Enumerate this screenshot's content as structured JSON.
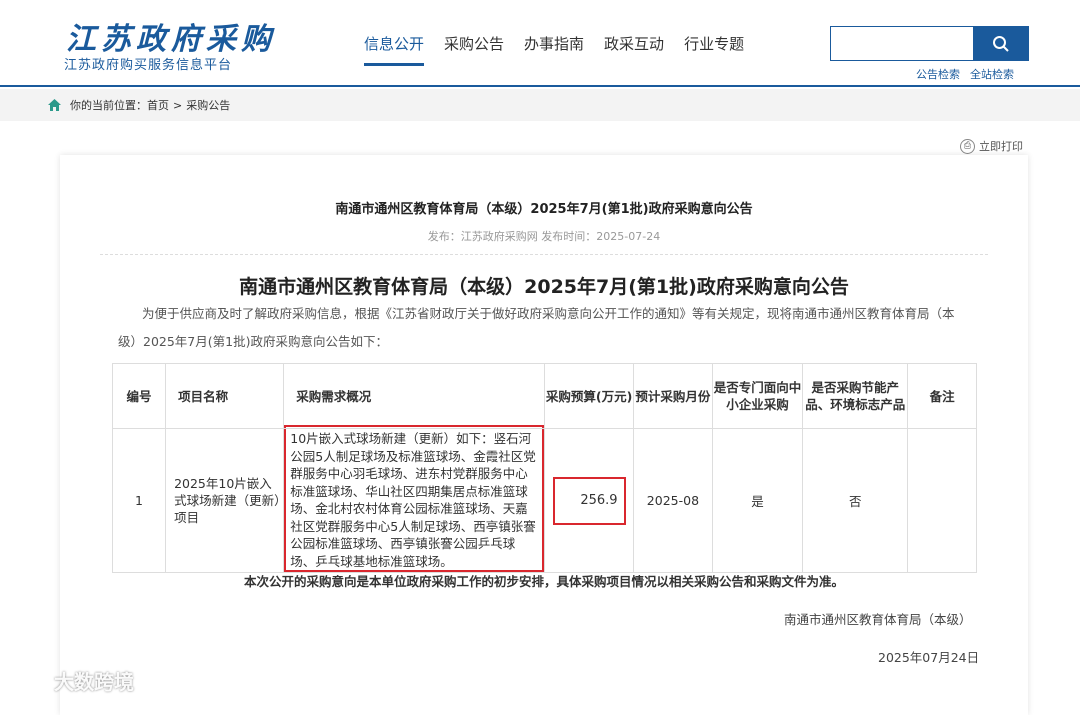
{
  "header": {
    "logo_title": "江苏政府采购",
    "logo_subtitle": "江苏政府购买服务信息平台",
    "logo_seal": "政府采购",
    "nav": [
      {
        "label": "信息公开"
      },
      {
        "label": "采购公告"
      },
      {
        "label": "办事指南"
      },
      {
        "label": "政采互动"
      },
      {
        "label": "行业专题"
      }
    ],
    "search": {
      "value": "",
      "placeholder": ""
    },
    "search_links": [
      "公告检索",
      "全站检索"
    ]
  },
  "breadcrumb": {
    "label": "你的当前位置：",
    "home": "首页",
    "separator": ">",
    "current": "采购公告"
  },
  "print_label": "立即打印",
  "article": {
    "page_title": "南通市通州区教育体育局（本级）2025年7月(第1批)政府采购意向公告",
    "meta": "发布：江苏政府采购网   发布时间：2025-07-24",
    "doc_title": "南通市通州区教育体育局（本级）2025年7月(第1批)政府采购意向公告",
    "intro": "为便于供应商及时了解政府采购信息，根据《江苏省财政厅关于做好政府采购意向公开工作的通知》等有关规定，现将南通市通州区教育体育局（本级）2025年7月(第1批)政府采购意向公告如下：",
    "table": {
      "headers": [
        "编号",
        "项目名称",
        "采购需求概况",
        "采购预算(万元)",
        "预计采购月份",
        "是否专门面向中小企业采购",
        "是否采购节能产品、环境标志产品",
        "备注"
      ],
      "rows": [
        {
          "no": "1",
          "name": "2025年10片嵌入式球场新建（更新）项目",
          "description": "10片嵌入式球场新建（更新）如下：竖石河公园5人制足球场及标准篮球场、金霞社区党群服务中心羽毛球场、进东村党群服务中心标准篮球场、华山社区四期集居点标准篮球场、金北村农村体育公园标准篮球场、天嘉社区党群服务中心5人制足球场、西亭镇张謇公园标准篮球场、西亭镇张謇公园乒乓球场、乒乓球基地标准篮球场。",
          "budget": "256.9",
          "month": "2025-08",
          "sme": "是",
          "green": "否",
          "remark": ""
        }
      ]
    },
    "note": "本次公开的采购意向是本单位政府采购工作的初步安排，具体采购项目情况以相关采购公告和采购文件为准。",
    "sign_org": "南通市通州区教育体育局（本级）",
    "sign_date": "2025年07月24日"
  },
  "watermark": "大数跨境",
  "colors": {
    "brand": "#1a5a9c",
    "highlight": "#d9272e"
  }
}
